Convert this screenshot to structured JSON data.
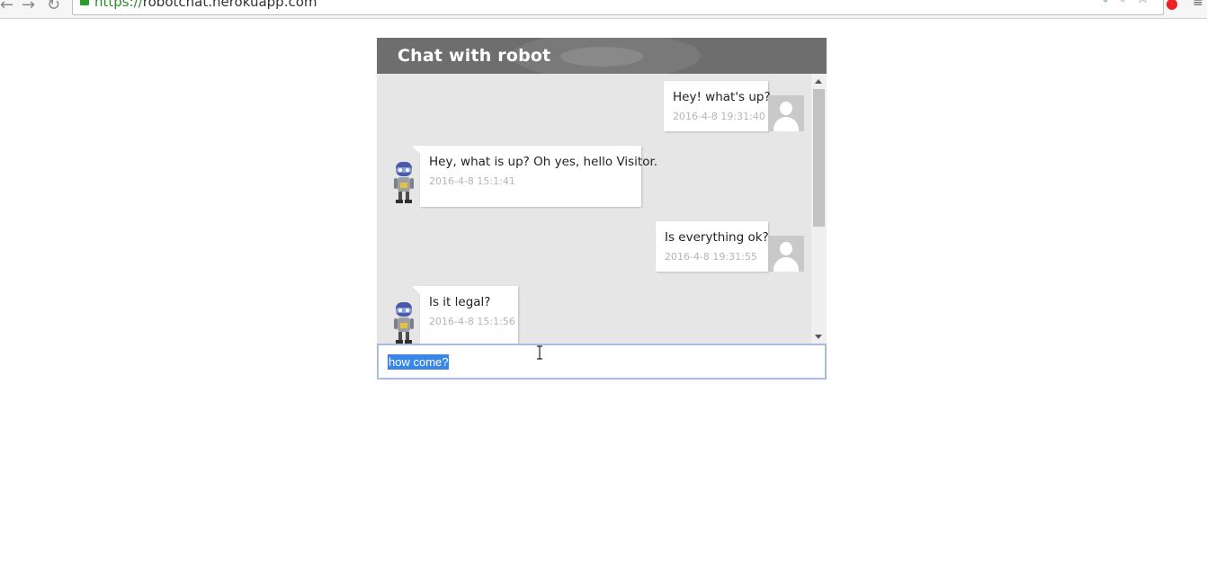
{
  "browser": {
    "url_scheme": "https://",
    "url_host": "robotchat.herokuapp.com"
  },
  "chat": {
    "title": "Chat with robot",
    "messages": [
      {
        "sender": "user",
        "text": "Hey! what's up?",
        "time": "2016-4-8 19:31:40"
      },
      {
        "sender": "robot",
        "text": "Hey, what is up? Oh yes, hello Visitor.",
        "time": "2016-4-8 15:1:41"
      },
      {
        "sender": "user",
        "text": "Is everything ok?",
        "time": "2016-4-8 19:31:55"
      },
      {
        "sender": "robot",
        "text": "Is it legal?",
        "time": "2016-4-8 15:1:56"
      }
    ],
    "input_value": "how come?"
  },
  "colors": {
    "header_bg": "#6e6e6e",
    "messages_bg": "#e6e6e6",
    "selection": "#3a86e6",
    "input_border": "#a9bbe0"
  }
}
